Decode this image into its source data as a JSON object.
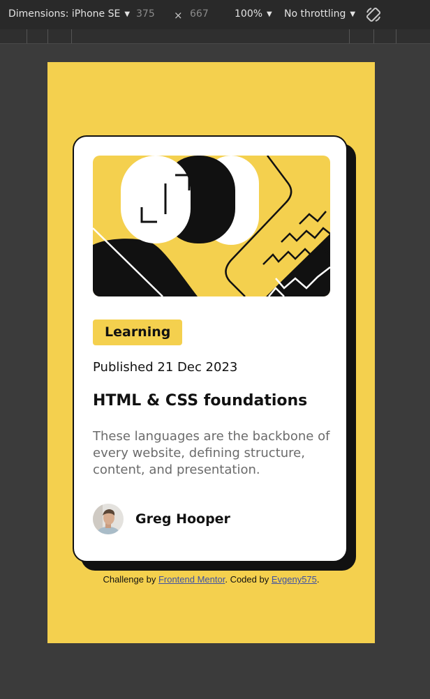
{
  "devtools": {
    "dimensions_label": "Dimensions: iPhone SE",
    "width": "375",
    "times": "×",
    "height": "667",
    "zoom": "100%",
    "throttling": "No throttling",
    "icons": {
      "dropdown": "caret-down-icon",
      "rotate": "rotate-icon"
    }
  },
  "card": {
    "tag": "Learning",
    "published": "Published 21 Dec 2023",
    "title": "HTML & CSS foundations",
    "description": "These languages are the backbone of every website, defining structure, content, and presentation.",
    "author": "Greg Hooper"
  },
  "attribution": {
    "prefix": "Challenge by ",
    "fm_link": "Frontend Mentor",
    "middle": ". Coded by ",
    "author_link": "Evgeny575",
    "suffix": "."
  },
  "colors": {
    "page_background": "#3b3b3b",
    "toolbar": "#292929",
    "accent_yellow": "#f4d04e",
    "card": "#ffffff",
    "ink": "#111111",
    "muted_text": "#6b6b6b",
    "link": "#3e52a3"
  }
}
